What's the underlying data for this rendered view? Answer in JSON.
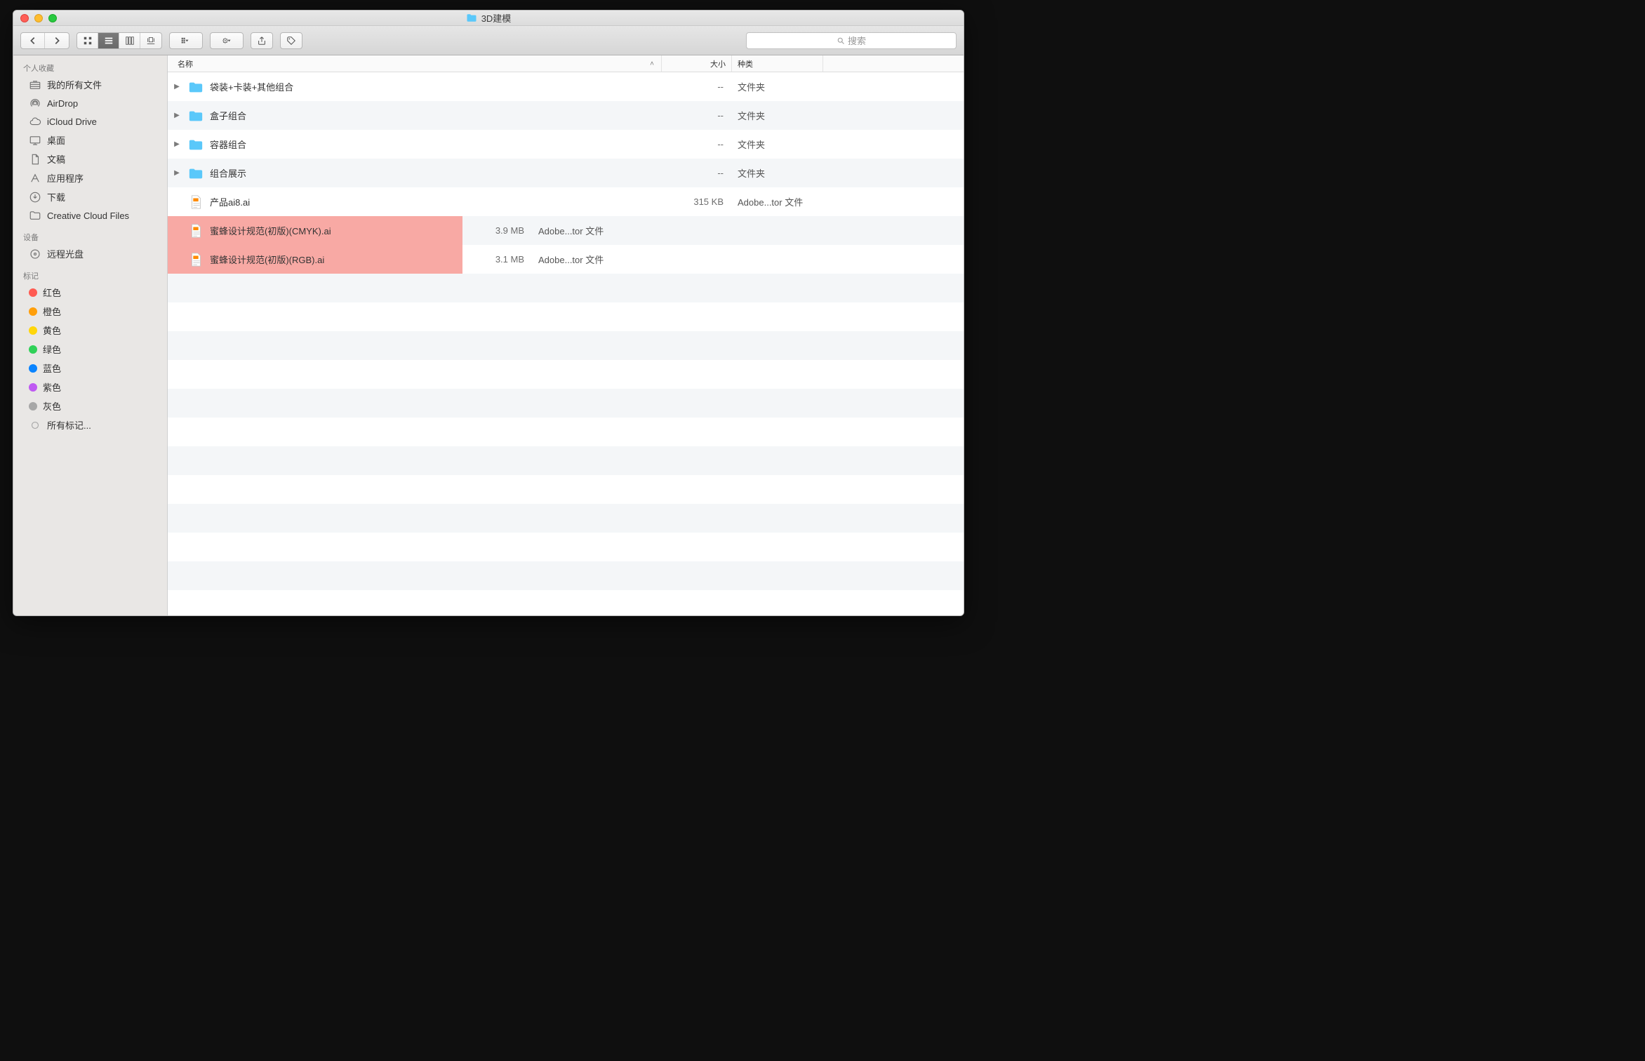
{
  "window": {
    "title": "3D建模"
  },
  "toolbar": {
    "search_placeholder": "搜索"
  },
  "columns": {
    "name": "名称",
    "size": "大小",
    "kind": "种类"
  },
  "sidebar": {
    "favorites_header": "个人收藏",
    "favorites": [
      {
        "icon": "all-my-files",
        "label": "我的所有文件"
      },
      {
        "icon": "airdrop",
        "label": "AirDrop"
      },
      {
        "icon": "icloud",
        "label": "iCloud Drive"
      },
      {
        "icon": "desktop",
        "label": "桌面"
      },
      {
        "icon": "documents",
        "label": "文稿"
      },
      {
        "icon": "applications",
        "label": "应用程序"
      },
      {
        "icon": "downloads",
        "label": "下载"
      },
      {
        "icon": "folder",
        "label": "Creative Cloud Files"
      }
    ],
    "devices_header": "设备",
    "devices": [
      {
        "icon": "disc",
        "label": "远程光盘"
      }
    ],
    "tags_header": "标记",
    "tags": [
      {
        "color": "#ff5b52",
        "label": "红色"
      },
      {
        "color": "#ff9f0a",
        "label": "橙色"
      },
      {
        "color": "#ffd60a",
        "label": "黄色"
      },
      {
        "color": "#30d158",
        "label": "绿色"
      },
      {
        "color": "#0a84ff",
        "label": "蓝色"
      },
      {
        "color": "#bf5af2",
        "label": "紫色"
      },
      {
        "color": "#a7a7a7",
        "label": "灰色"
      },
      {
        "icon": "all-tags",
        "label": "所有标记..."
      }
    ]
  },
  "files": [
    {
      "type": "folder",
      "name": "袋装+卡装+其他组合",
      "size": "--",
      "kind": "文件夹",
      "highlight": false
    },
    {
      "type": "folder",
      "name": "盒子组合",
      "size": "--",
      "kind": "文件夹",
      "highlight": false
    },
    {
      "type": "folder",
      "name": "容器组合",
      "size": "--",
      "kind": "文件夹",
      "highlight": false
    },
    {
      "type": "folder",
      "name": "组合展示",
      "size": "--",
      "kind": "文件夹",
      "highlight": false
    },
    {
      "type": "ai",
      "name": "产品ai8.ai",
      "size": "315 KB",
      "kind": "Adobe...tor 文件",
      "highlight": false
    },
    {
      "type": "ai",
      "name": "蜜蜂设计规范(初版)(CMYK).ai",
      "size": "3.9 MB",
      "kind": "Adobe...tor 文件",
      "highlight": true
    },
    {
      "type": "ai",
      "name": "蜜蜂设计规范(初版)(RGB).ai",
      "size": "3.1 MB",
      "kind": "Adobe...tor 文件",
      "highlight": true
    }
  ]
}
